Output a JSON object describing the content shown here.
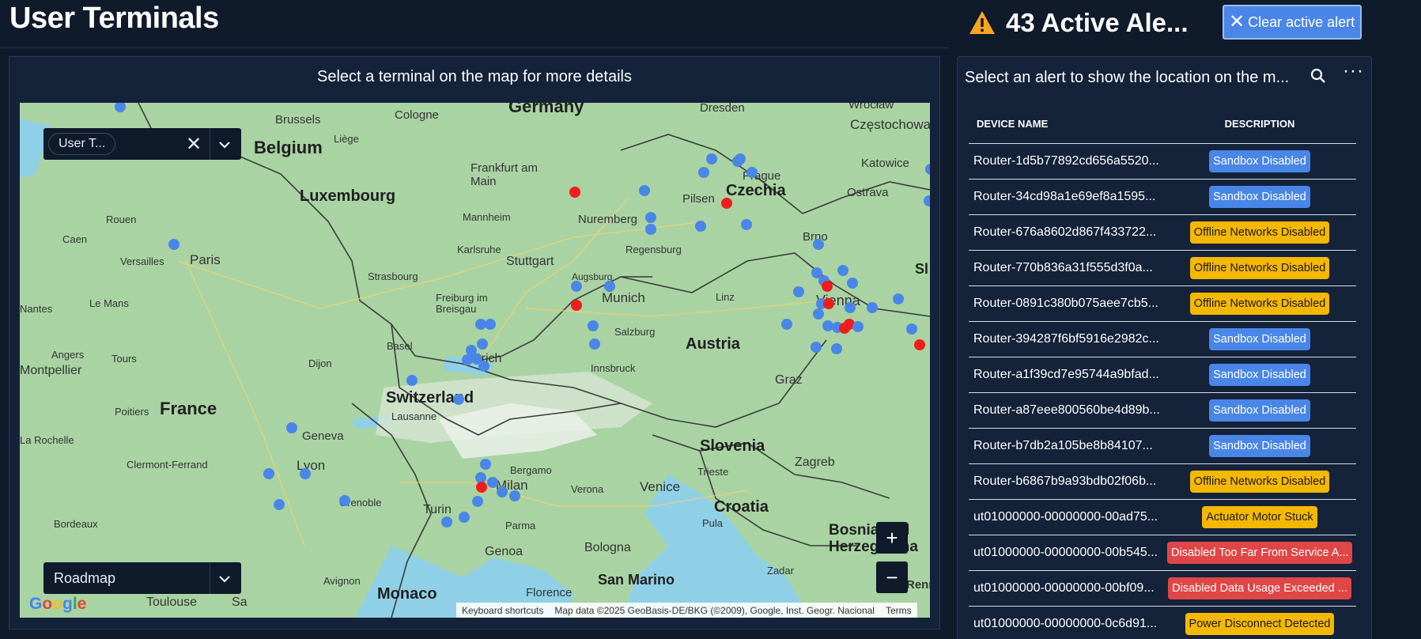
{
  "page": {
    "title": "User Terminals"
  },
  "alerts_header": {
    "count_text": "43 Active Ale...",
    "clear_button": "Clear active alert ..."
  },
  "map_panel": {
    "caption": "Select a terminal on the map for more details",
    "filter_chip": "User T...",
    "map_type": "Roadmap",
    "zoom_in": "+",
    "zoom_out": "−",
    "attribution": [
      "Keyboard shortcuts",
      "Map data ©2025 GeoBasis-DE/BKG (©2009), Google, Inst. Geogr. Nacional",
      "Terms"
    ],
    "countries": [
      "Germany",
      "Belgium",
      "Luxembourg",
      "France",
      "Switzerland",
      "Austria",
      "Czechia",
      "Slovenia",
      "Croatia",
      "Bosnia and Herzegovina",
      "Monaco",
      "San Marino",
      "Sl"
    ],
    "cities": [
      "Brussels",
      "Liège",
      "Cologne",
      "Dresden",
      "Wrocław",
      "Częstochowa",
      "Frankfurt am Main",
      "Prague",
      "Pilsen",
      "Katowice",
      "Ostrava",
      "Rouen",
      "Caen",
      "Mannheim",
      "Nuremberg",
      "Brno",
      "Karlsruhe",
      "Regensburg",
      "Versailles",
      "Paris",
      "Stuttgart",
      "Strasbourg",
      "Augsburg",
      "Linz",
      "Le Mans",
      "Freiburg im Breisgau",
      "Munich",
      "Vienna",
      "Angers",
      "Tours",
      "Basel",
      "Zürich",
      "Salzburg",
      "Dijon",
      "Innsbruck",
      "Graz",
      "Poitiers",
      "Lausanne",
      "Geneva",
      "La Rochelle",
      "Clermont-Ferrand",
      "Lyon",
      "Bergamo",
      "Trieste",
      "Zagreb",
      "Milan",
      "Verona",
      "Venice",
      "Grenoble",
      "Turin",
      "Bordeaux",
      "Parma",
      "Pula",
      "Genoa",
      "Bologna",
      "Zadar",
      "Avignon",
      "Florence",
      "Toulouse",
      "Montpellier",
      "Nantes",
      "Rennes",
      "Sa"
    ],
    "google_logo": [
      "G",
      "o",
      "o",
      "g",
      "l",
      "e"
    ]
  },
  "alerts_panel": {
    "caption": "Select an alert to show the location on the m...",
    "columns": {
      "device": "DEVICE NAME",
      "description": "DESCRIPTION"
    },
    "rows": [
      {
        "device": "Router-1d5b77892cd656a5520...",
        "description": "Sandbox Disabled",
        "color": "#4a86e8",
        "text_color": "#ffffff"
      },
      {
        "device": "Router-34cd98a1e69ef8a1595...",
        "description": "Sandbox Disabled",
        "color": "#4a86e8",
        "text_color": "#ffffff"
      },
      {
        "device": "Router-676a8602d867f433722...",
        "description": "Offline Networks Disabled",
        "color": "#f5b800",
        "text_color": "#1b1b1b"
      },
      {
        "device": "Router-770b836a31f555d3f0a...",
        "description": "Offline Networks Disabled",
        "color": "#f5b800",
        "text_color": "#1b1b1b"
      },
      {
        "device": "Router-0891c380b075aee7cb5...",
        "description": "Offline Networks Disabled",
        "color": "#f5b800",
        "text_color": "#1b1b1b"
      },
      {
        "device": "Router-394287f6bf5916e2982c...",
        "description": "Sandbox Disabled",
        "color": "#4a86e8",
        "text_color": "#ffffff"
      },
      {
        "device": "Router-a1f39cd7e95744a9bfad...",
        "description": "Sandbox Disabled",
        "color": "#4a86e8",
        "text_color": "#ffffff"
      },
      {
        "device": "Router-a87eee800560be4d89b...",
        "description": "Sandbox Disabled",
        "color": "#4a86e8",
        "text_color": "#ffffff"
      },
      {
        "device": "Router-b7db2a105be8b84107...",
        "description": "Sandbox Disabled",
        "color": "#4a86e8",
        "text_color": "#ffffff"
      },
      {
        "device": "Router-b6867b9a93bdb02f06b...",
        "description": "Offline Networks Disabled",
        "color": "#f5b800",
        "text_color": "#1b1b1b"
      },
      {
        "device": "ut01000000-00000000-00ad75...",
        "description": "Actuator Motor Stuck",
        "color": "#f5b800",
        "text_color": "#1b1b1b"
      },
      {
        "device": "ut01000000-00000000-00b545...",
        "description": "Disabled Too Far From Service A...",
        "color": "#e04646",
        "text_color": "#ffffff"
      },
      {
        "device": "ut01000000-00000000-00bf09...",
        "description": "Disabled Data Usage Exceeded ...",
        "color": "#e04646",
        "text_color": "#ffffff"
      },
      {
        "device": "ut01000000-00000000-0c6d91...",
        "description": "Power Disconnect Detected",
        "color": "#f5b800",
        "text_color": "#1b1b1b"
      }
    ]
  },
  "colors": {
    "background": "#0f1a2b",
    "card": "#14223a",
    "accent": "#4a86e8",
    "marker_blue": "#4a86e8",
    "marker_red": "#ef1d1d",
    "map_land": "#a9d3a3",
    "map_water": "#8fd0e6"
  }
}
